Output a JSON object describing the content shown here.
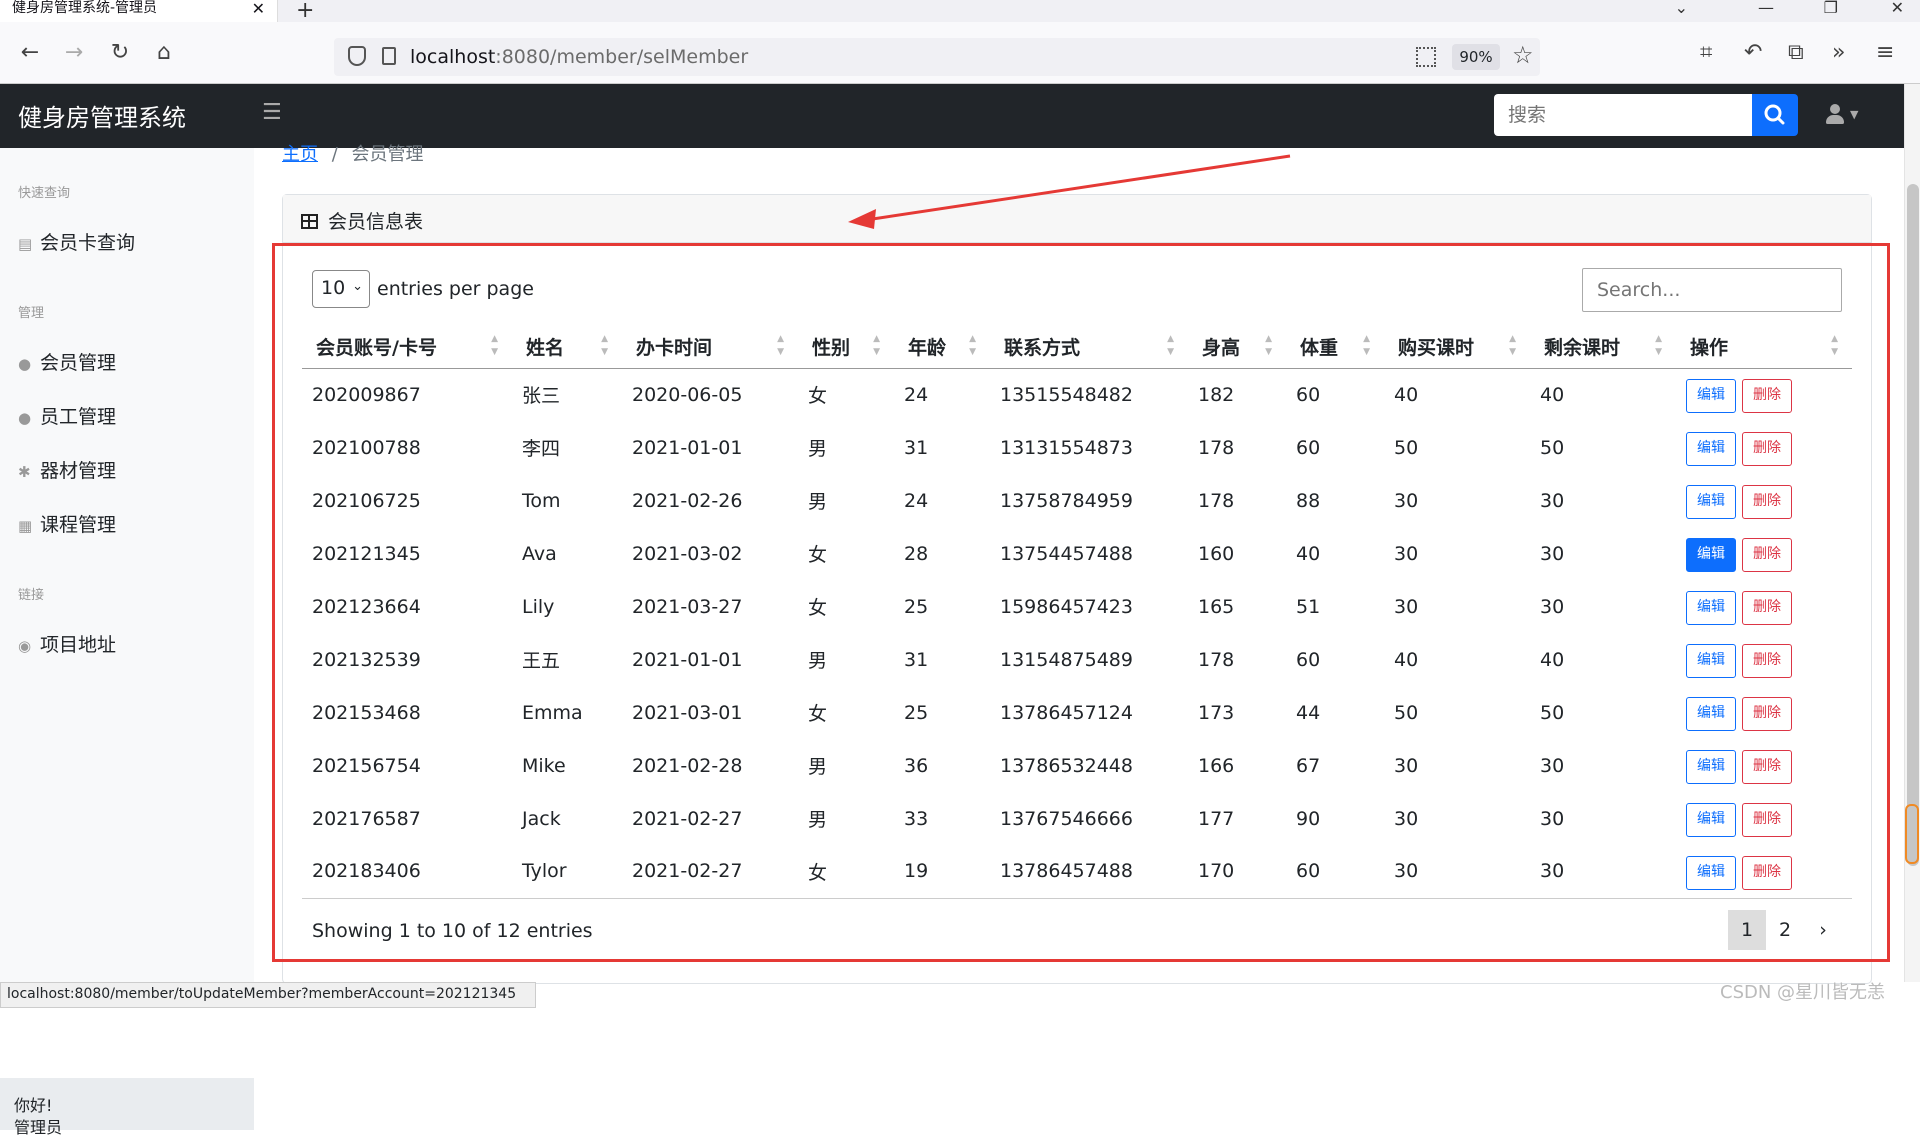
{
  "browser": {
    "tab_title": "健身房管理系统-管理员",
    "tab_close": "✕",
    "new_tab": "+",
    "url_host": "localhost",
    "url_rest": ":8080/member/selMember",
    "zoom": "90%"
  },
  "app": {
    "brand": "健身房管理系统",
    "search_placeholder": "搜索"
  },
  "sidebar": {
    "sections": [
      {
        "heading": "快速查询",
        "items": [
          {
            "label": "会员卡查询",
            "icon": "id-card-icon"
          }
        ]
      },
      {
        "heading": "管理",
        "items": [
          {
            "label": "会员管理",
            "icon": "user-icon"
          },
          {
            "label": "员工管理",
            "icon": "user-tie-icon"
          },
          {
            "label": "器材管理",
            "icon": "equipment-icon"
          },
          {
            "label": "课程管理",
            "icon": "calendar-icon"
          }
        ]
      },
      {
        "heading": "链接",
        "items": [
          {
            "label": "项目地址",
            "icon": "github-icon"
          }
        ]
      }
    ],
    "footer_greeting": "你好!",
    "footer_role": "管理员"
  },
  "breadcrumb": {
    "home": "主页",
    "sep": "/",
    "current": "会员管理"
  },
  "card": {
    "title": "会员信息表"
  },
  "datatable": {
    "per_page": "10",
    "per_page_label": "entries per page",
    "search_placeholder": "Search...",
    "columns": [
      "会员账号/卡号",
      "姓名",
      "办卡时间",
      "性别",
      "年龄",
      "联系方式",
      "身高",
      "体重",
      "购买课时",
      "剩余课时",
      "操作"
    ],
    "rows": [
      [
        "202009867",
        "张三",
        "2020-06-05",
        "女",
        "24",
        "13515548482",
        "182",
        "60",
        "40",
        "40"
      ],
      [
        "202100788",
        "李四",
        "2021-01-01",
        "男",
        "31",
        "13131554873",
        "178",
        "60",
        "50",
        "50"
      ],
      [
        "202106725",
        "Tom",
        "2021-02-26",
        "男",
        "24",
        "13758784959",
        "178",
        "88",
        "30",
        "30"
      ],
      [
        "202121345",
        "Ava",
        "2021-03-02",
        "女",
        "28",
        "13754457488",
        "160",
        "40",
        "30",
        "30"
      ],
      [
        "202123664",
        "Lily",
        "2021-03-27",
        "女",
        "25",
        "15986457423",
        "165",
        "51",
        "30",
        "30"
      ],
      [
        "202132539",
        "王五",
        "2021-01-01",
        "男",
        "31",
        "13154875489",
        "178",
        "60",
        "40",
        "40"
      ],
      [
        "202153468",
        "Emma",
        "2021-03-01",
        "女",
        "25",
        "13786457124",
        "173",
        "44",
        "50",
        "50"
      ],
      [
        "202156754",
        "Mike",
        "2021-02-28",
        "男",
        "36",
        "13786532448",
        "166",
        "67",
        "30",
        "30"
      ],
      [
        "202176587",
        "Jack",
        "2021-02-27",
        "男",
        "33",
        "13767546666",
        "177",
        "90",
        "30",
        "30"
      ],
      [
        "202183406",
        "Tylor",
        "2021-02-27",
        "女",
        "19",
        "13786457488",
        "170",
        "60",
        "30",
        "30"
      ]
    ],
    "edit_label": "编辑",
    "delete_label": "删除",
    "active_edit_row": 3,
    "showing": "Showing 1 to 10 of 12 entries",
    "pages": [
      "1",
      "2"
    ],
    "next": "›"
  },
  "status_url": "localhost:8080/member/toUpdateMember?memberAccount=202121345",
  "watermark": "CSDN @星川皆无恙",
  "colors": {
    "primary": "#0d6efd",
    "danger": "#dc3545",
    "annotation": "#e53935",
    "navbar": "#212529"
  }
}
